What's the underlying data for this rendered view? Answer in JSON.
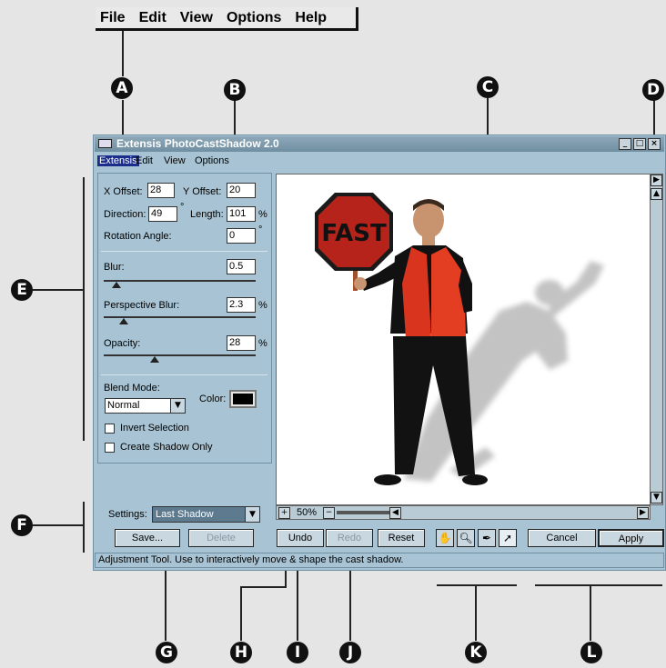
{
  "top_menu": [
    "File",
    "Edit",
    "View",
    "Options",
    "Help"
  ],
  "callouts": [
    "A",
    "B",
    "C",
    "D",
    "E",
    "F",
    "G",
    "H",
    "I",
    "J",
    "K",
    "L"
  ],
  "window": {
    "title": "Extensis PhotoCastShadow 2.0",
    "controls": [
      "_",
      "□",
      "×"
    ],
    "menu": [
      "Extensis",
      "Edit",
      "View",
      "Options"
    ]
  },
  "panel": {
    "x_offset_label": "X Offset:",
    "x_offset": "28",
    "y_offset_label": "Y Offset:",
    "y_offset": "20",
    "direction_label": "Direction:",
    "direction": "49",
    "direction_unit": "°",
    "length_label": "Length:",
    "length": "101",
    "length_unit": "%",
    "rotation_label": "Rotation Angle:",
    "rotation": "0",
    "rotation_unit": "°",
    "blur_label": "Blur:",
    "blur": "0.5",
    "persp_blur_label": "Perspective Blur:",
    "persp_blur": "2.3",
    "persp_blur_unit": "%",
    "opacity_label": "Opacity:",
    "opacity": "28",
    "opacity_unit": "%",
    "blend_label": "Blend Mode:",
    "blend_value": "Normal",
    "color_label": "Color:",
    "shadow_color": "#000000",
    "invert_label": "Invert Selection",
    "shadow_only_label": "Create Shadow Only"
  },
  "settings": {
    "label": "Settings:",
    "value": "Last Shadow",
    "save": "Save...",
    "delete": "Delete"
  },
  "zoom": {
    "value": "50%",
    "plus": "+",
    "minus": "−"
  },
  "actions": {
    "undo": "Undo",
    "redo": "Redo",
    "reset": "Reset",
    "cancel": "Cancel",
    "apply": "Apply"
  },
  "tools": [
    "hand-icon",
    "zoom-icon",
    "eyedropper-icon",
    "adjust-arrow-icon"
  ],
  "sign_text": "FAST",
  "status": "Adjustment Tool. Use to interactively move & shape the cast shadow."
}
